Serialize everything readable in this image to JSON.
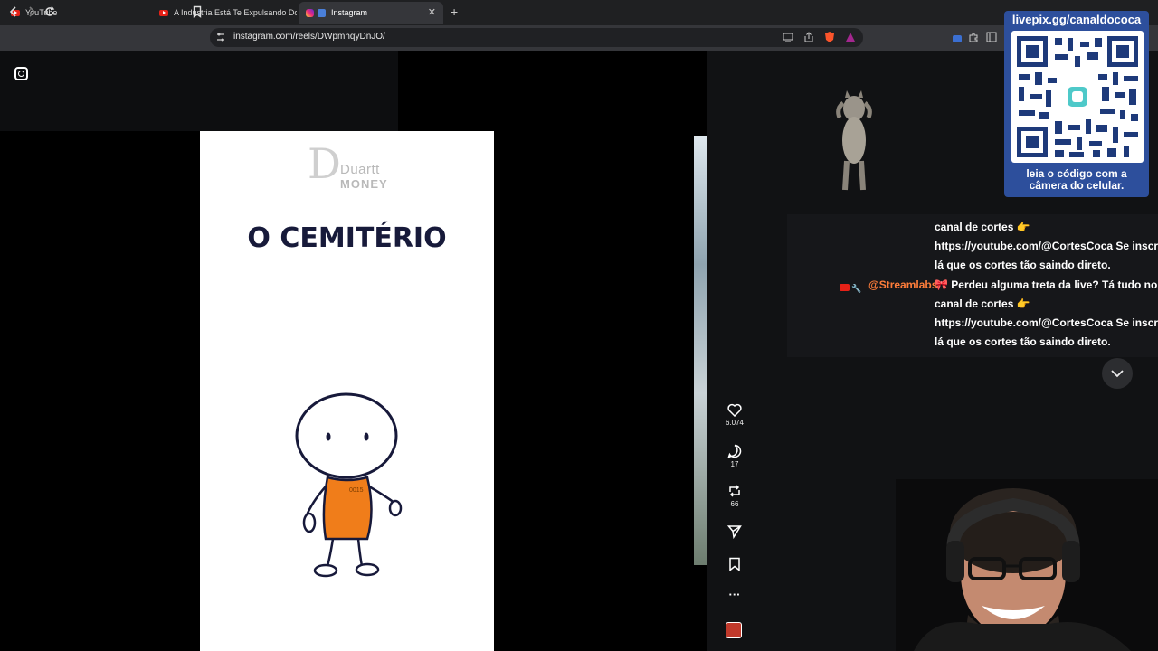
{
  "browser": {
    "tabs": [
      {
        "label": "YouTube",
        "icon": "youtube-icon"
      },
      {
        "label": "A Indústria Está Te Expulsando Do G",
        "icon": "youtube-icon"
      },
      {
        "label": "Instagram",
        "icon": "instagram-icon",
        "active": true
      }
    ],
    "url": "instagram.com/reels/DWpmhqyDnJO/"
  },
  "reel": {
    "logo_top": "Duartt",
    "logo_bottom": "MONEY",
    "title": "O CEMITÉRIO",
    "shirt_number": "0015",
    "actions": {
      "likes": "6.074",
      "comments": "17",
      "reposts": "66"
    }
  },
  "overlay": {
    "qr_header": "livepix.gg/canaldococa",
    "qr_footer_1": "leia o código com a",
    "qr_footer_2": "câmera do celular.",
    "chat": {
      "line1": "canal de cortes 👉",
      "line2": "https://youtube.com/@CortesCoca Se inscreve",
      "line3": "lá que os cortes tão saindo direto.",
      "user": "@Streamlabs",
      "line4": "🎀 Perdeu alguma treta da live? Tá tudo no",
      "line5": "canal de cortes 👉",
      "line6": "https://youtube.com/@CortesCoca Se inscreve",
      "line7": "lá que os cortes tão saindo direto."
    }
  },
  "colors": {
    "title": "#171a3a",
    "shirt": "#f07d1a",
    "username": "#ff7d3a",
    "qr_panel": "#2d4f9c"
  }
}
